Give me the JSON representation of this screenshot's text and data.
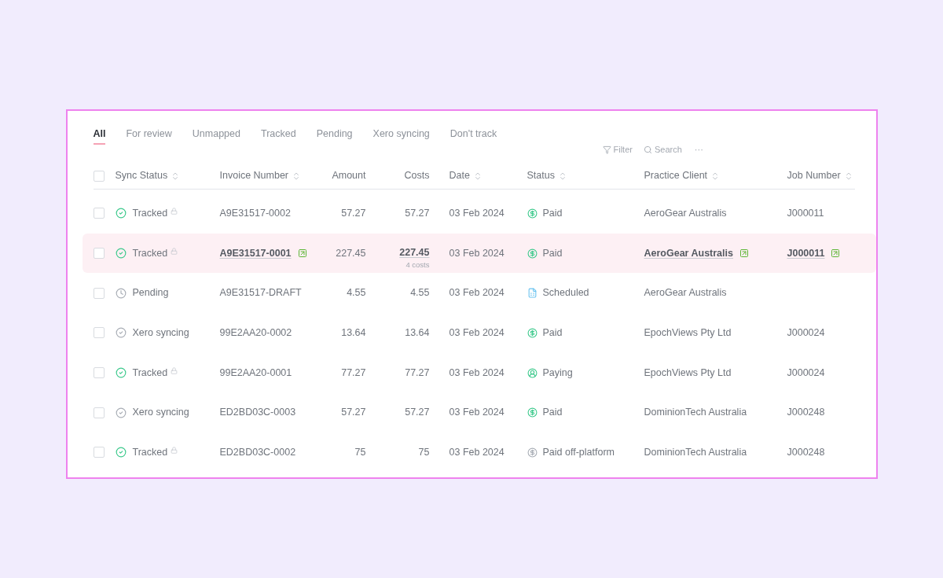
{
  "tabs": [
    {
      "label": "All",
      "selected": true
    },
    {
      "label": "For review",
      "selected": false
    },
    {
      "label": "Unmapped",
      "selected": false
    },
    {
      "label": "Tracked",
      "selected": false
    },
    {
      "label": "Pending",
      "selected": false
    },
    {
      "label": "Xero syncing",
      "selected": false
    },
    {
      "label": "Don't track",
      "selected": false
    }
  ],
  "toolbar": {
    "filter": "Filter",
    "search": "Search",
    "more": "···"
  },
  "table": {
    "select_all_checked": false,
    "columns": [
      {
        "label": "Sync Status",
        "sortable": true,
        "kind": "text"
      },
      {
        "label": "Invoice Number",
        "sortable": true,
        "kind": "text"
      },
      {
        "label": "Amount",
        "sortable": false,
        "kind": "number"
      },
      {
        "label": "Costs",
        "sortable": false,
        "kind": "number"
      },
      {
        "label": "Date",
        "sortable": true,
        "kind": "text"
      },
      {
        "label": "Status",
        "sortable": true,
        "kind": "text"
      },
      {
        "label": "Practice Client",
        "sortable": true,
        "kind": "text"
      },
      {
        "label": "Job Number",
        "sortable": true,
        "kind": "text"
      }
    ],
    "rows": [
      {
        "checked": false,
        "highlighted": false,
        "sync": {
          "label": "Tracked",
          "kind": "tracked",
          "locked": true
        },
        "invoice": "A9E31517-0002",
        "amount": "57.27",
        "costs": "57.27",
        "date": "03 Feb 2024",
        "status": {
          "label": "Paid",
          "kind": "paid"
        },
        "client": "AeroGear Australis",
        "job": "J000011"
      },
      {
        "checked": false,
        "highlighted": true,
        "sync": {
          "label": "Tracked",
          "kind": "tracked",
          "locked": true
        },
        "invoice": "A9E31517-0001",
        "amount": "227.45",
        "costs": "227.45",
        "costs_note": "4 costs",
        "date": "03 Feb 2024",
        "status": {
          "label": "Paid",
          "kind": "paid"
        },
        "client": "AeroGear Australis",
        "job": "J000011"
      },
      {
        "checked": false,
        "highlighted": false,
        "sync": {
          "label": "Pending",
          "kind": "pending",
          "locked": false
        },
        "invoice": "A9E31517-DRAFT",
        "amount": "4.55",
        "costs": "4.55",
        "date": "03 Feb 2024",
        "status": {
          "label": "Scheduled",
          "kind": "scheduled"
        },
        "client": "AeroGear Australis"
      },
      {
        "checked": false,
        "highlighted": false,
        "sync": {
          "label": "Xero syncing",
          "kind": "syncing",
          "locked": false
        },
        "invoice": "99E2AA20-0002",
        "amount": "13.64",
        "costs": "13.64",
        "date": "03 Feb 2024",
        "status": {
          "label": "Paid",
          "kind": "paid"
        },
        "client": "EpochViews Pty Ltd",
        "job": "J000024"
      },
      {
        "checked": false,
        "highlighted": false,
        "sync": {
          "label": "Tracked",
          "kind": "tracked",
          "locked": true
        },
        "invoice": "99E2AA20-0001",
        "amount": "77.27",
        "costs": "77.27",
        "date": "03 Feb 2024",
        "status": {
          "label": "Paying",
          "kind": "paying"
        },
        "client": "EpochViews Pty Ltd",
        "job": "J000024"
      },
      {
        "checked": false,
        "highlighted": false,
        "sync": {
          "label": "Xero syncing",
          "kind": "syncing",
          "locked": false
        },
        "invoice": "ED2BD03C-0003",
        "amount": "57.27",
        "costs": "57.27",
        "date": "03 Feb 2024",
        "status": {
          "label": "Paid",
          "kind": "paid"
        },
        "client": "DominionTech Australia",
        "job": "J000248"
      },
      {
        "checked": false,
        "highlighted": false,
        "sync": {
          "label": "Tracked",
          "kind": "tracked",
          "locked": true
        },
        "invoice": "ED2BD03C-0002",
        "amount": "75",
        "costs": "75",
        "date": "03 Feb 2024",
        "status": {
          "label": "Paid off-platform",
          "kind": "offplatform"
        },
        "client": "DominionTech Australia",
        "job": "J000248"
      }
    ]
  }
}
